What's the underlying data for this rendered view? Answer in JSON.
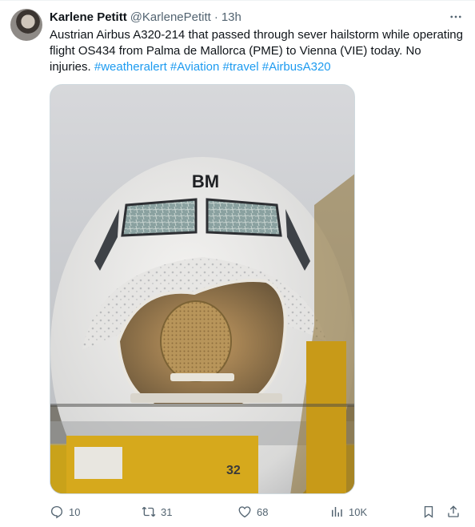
{
  "author": {
    "name": "Karlene Petitt",
    "handle": "@KarlenePetitt",
    "separator": "·",
    "time": "13h"
  },
  "more_icon": "more-horizontal-icon",
  "tweet": {
    "text": "Austrian Airbus A320-214 that passed through sever hailstorm while operating flight OS434 from Palma de Mallorca (PME) to Vienna (VIE) today. No injuries. ",
    "hashtags": [
      "#weatheralert",
      "#Aviation",
      "#travel",
      "#AirbusA320"
    ]
  },
  "media": {
    "nose_label": "BM",
    "vehicle_label": "32"
  },
  "actions": {
    "replies": "10",
    "reposts": "31",
    "likes": "68",
    "views": "10K"
  },
  "colors": {
    "text": "#0f1419",
    "secondary": "#536471",
    "link": "#1d9bf0"
  }
}
